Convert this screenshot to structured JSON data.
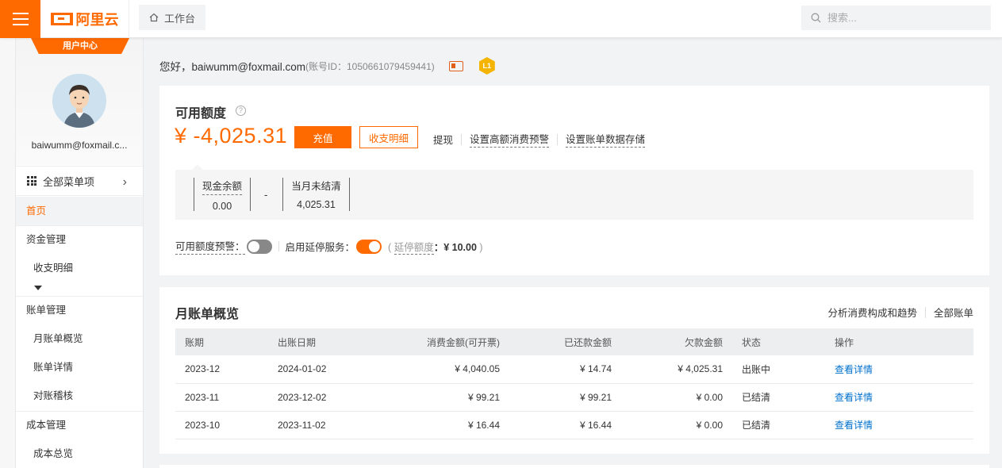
{
  "header": {
    "logo_text": "阿里云",
    "workbench_label": "工作台",
    "search_placeholder": "搜索..."
  },
  "sidebar": {
    "user_center_tab": "用户中心",
    "user_email": "baiwumm@foxmail.c...",
    "all_menu_label": "全部菜单项",
    "items": [
      {
        "label": "首页",
        "active": true
      },
      {
        "label": "资金管理"
      },
      {
        "label": "收支明细"
      },
      {
        "label": "账单管理"
      },
      {
        "label": "月账单概览"
      },
      {
        "label": "账单详情"
      },
      {
        "label": "对账稽核"
      },
      {
        "label": "成本管理"
      },
      {
        "label": "成本总览"
      }
    ]
  },
  "greeting": {
    "text": "您好，baiwumm@foxmail.com",
    "account_id": "(账号ID：1050661079459441)",
    "level_badge": "L1"
  },
  "credit": {
    "title": "可用额度",
    "balance": "¥ -4,025.31",
    "recharge_button": "充值",
    "detail_button": "收支明细",
    "links": [
      "提现",
      "设置高额消费预警",
      "设置账单数据存储"
    ],
    "cash_label": "现金余额",
    "cash_value": "0.00",
    "minus": "-",
    "unsettled_label": "当月未结清",
    "unsettled_value": "4,025.31",
    "quota_alert_label": "可用额度预警：",
    "quota_alert_on": false,
    "delay_service_label": "启用延停服务：",
    "delay_service_on": true,
    "delay_quota_open": "(",
    "delay_quota_label": "延停额度",
    "delay_quota_value": "：¥ 10.00",
    "delay_quota_close": ")"
  },
  "monthly": {
    "title": "月账单概览",
    "links": [
      "分析消费构成和趋势",
      "全部账单"
    ],
    "columns": [
      "账期",
      "出账日期",
      "消费金额(可开票)",
      "已还款金额",
      "欠款金额",
      "状态",
      "操作"
    ],
    "rows": [
      {
        "period": "2023-12",
        "date": "2024-01-02",
        "amount": "¥ 4,040.05",
        "paid": "¥ 14.74",
        "owed": "¥ 4,025.31",
        "status": "出账中",
        "action": "查看详情"
      },
      {
        "period": "2023-11",
        "date": "2023-12-02",
        "amount": "¥ 99.21",
        "paid": "¥ 99.21",
        "owed": "¥ 0.00",
        "status": "已结清",
        "action": "查看详情"
      },
      {
        "period": "2023-10",
        "date": "2023-11-02",
        "amount": "¥ 16.44",
        "paid": "¥ 16.44",
        "owed": "¥ 0.00",
        "status": "已结清",
        "action": "查看详情"
      }
    ]
  },
  "colors": {
    "brand_orange": "#ff6a00",
    "link_blue": "#0070cc"
  }
}
